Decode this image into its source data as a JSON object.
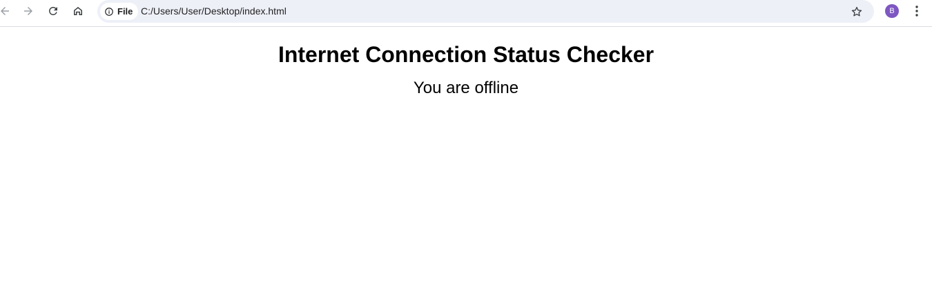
{
  "browser": {
    "address_bar": {
      "site_chip_label": "File",
      "url": "C:/Users/User/Desktop/index.html"
    },
    "profile_initial": "B",
    "icons": {
      "back": "back-arrow-icon",
      "forward": "forward-arrow-icon",
      "reload": "reload-icon",
      "home": "home-icon",
      "site_info": "info-icon",
      "bookmark": "star-icon",
      "menu": "more-vert-icon"
    },
    "colors": {
      "omnibox_bg": "#eef0f8",
      "avatar_bg": "#7e57c2"
    }
  },
  "page": {
    "title": "Internet Connection Status Checker",
    "status": "You are offline"
  }
}
